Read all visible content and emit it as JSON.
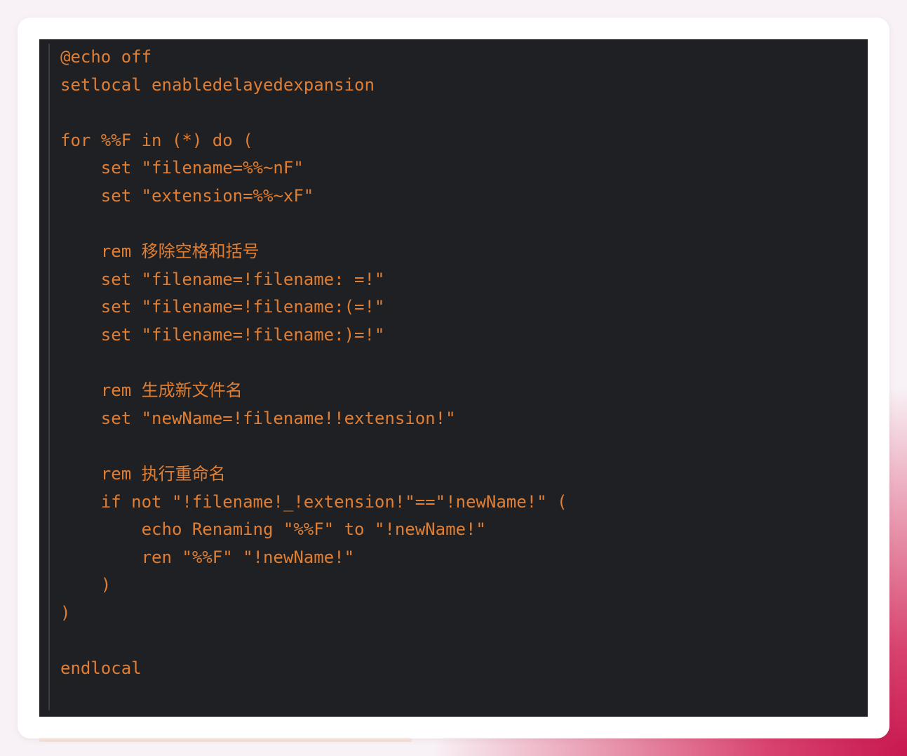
{
  "code_block": {
    "language": "batch",
    "text_color": "#e07e33",
    "background_color": "#1f2023",
    "lines": [
      "@echo off",
      "setlocal enabledelayedexpansion",
      "",
      "for %%F in (*) do (",
      "    set \"filename=%%~nF\"",
      "    set \"extension=%%~xF\"",
      "",
      "    rem 移除空格和括号",
      "    set \"filename=!filename: =!\"",
      "    set \"filename=!filename:(=!\"",
      "    set \"filename=!filename:)=!\"",
      "",
      "    rem 生成新文件名",
      "    set \"newName=!filename!!extension!\"",
      "",
      "    rem 执行重命名",
      "    if not \"!filename!_!extension!\"==\"!newName!\" (",
      "        echo Renaming \"%%F\" to \"!newName!\"",
      "        ren \"%%F\" \"!newName!\"",
      "    )",
      ")",
      "",
      "endlocal"
    ]
  }
}
